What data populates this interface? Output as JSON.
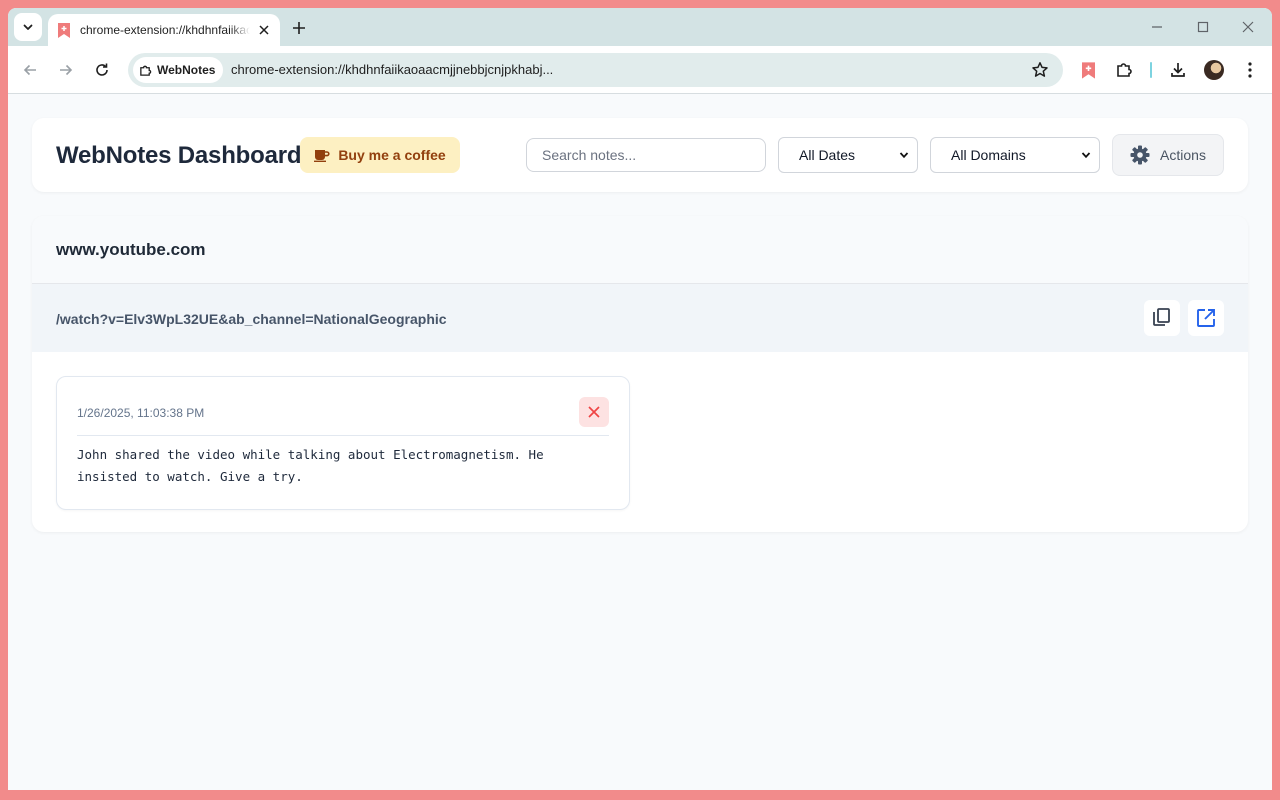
{
  "browser": {
    "tab_title": "chrome-extension://khdhnfaiikaoaacmjjnebbjcnjpkhabj/dashboard.html",
    "site_chip": "WebNotes",
    "url": "chrome-extension://khdhnfaiikaoaacmjjnebbjcnjpkhabj..."
  },
  "header": {
    "title": "WebNotes Dashboard",
    "coffee_label": "Buy me a coffee",
    "search_placeholder": "Search notes...",
    "date_filter": "All Dates",
    "domain_filter": "All Domains",
    "actions_label": "Actions"
  },
  "groups": [
    {
      "domain": "www.youtube.com",
      "path": "/watch?v=Elv3WpL32UE&ab_channel=NationalGeographic",
      "notes": [
        {
          "timestamp": "1/26/2025, 11:03:38 PM",
          "text": "John shared the video while talking about Electromagnetism. He insisted to watch. Give a try."
        }
      ]
    }
  ],
  "colors": {
    "frame": "#f28b8b",
    "accent_blue": "#1a73e8",
    "coffee_bg": "#fdf0c2",
    "coffee_text": "#92400e",
    "delete_bg": "#fde2e2",
    "delete_icon": "#ef4444"
  },
  "icons": {
    "tab_search": "chevron-down-icon",
    "favicon": "bookmark-plus-icon",
    "coffee": "coffee-cup-icon",
    "actions": "gear-icon",
    "copy": "copy-icon",
    "open": "open-external-icon",
    "delete": "close-icon"
  }
}
